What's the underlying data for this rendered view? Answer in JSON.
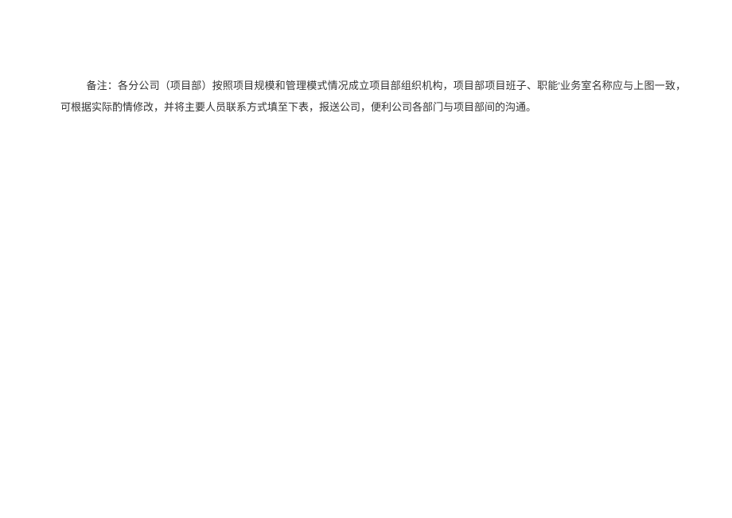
{
  "document": {
    "note_text": "备注：各分公司（项目部）按照项目规模和管理模式情况成立项目部组织机构，项目部项目班子、职能'业务室名称应与上图一致，可根据实际酌情修改，并将主要人员联系方式填至下表，报送公司，便利公司各部门与项目部间的沟通。"
  }
}
